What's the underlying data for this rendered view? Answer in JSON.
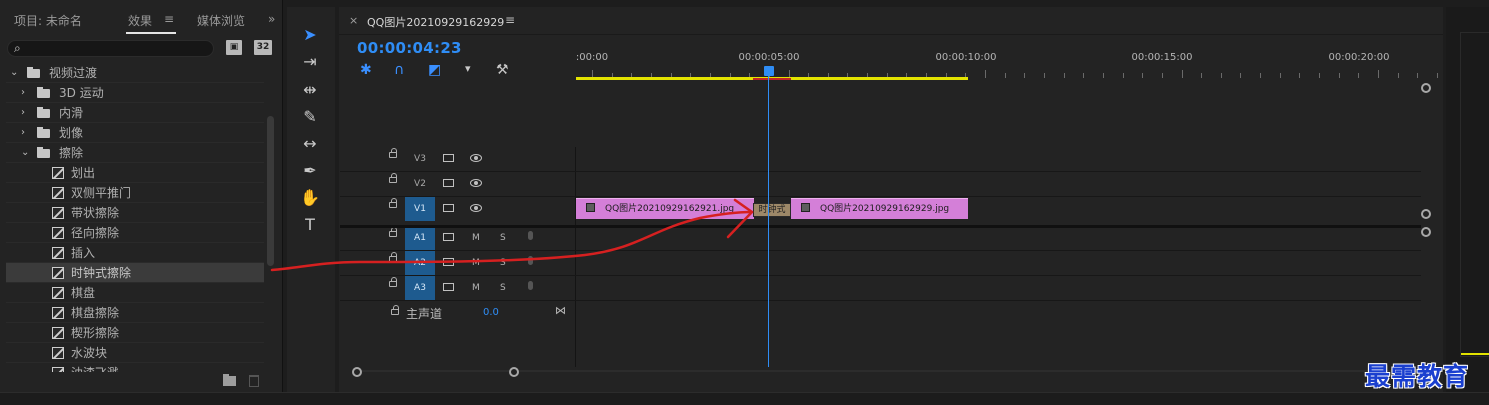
{
  "effects_panel": {
    "tabs": [
      {
        "label": "项目: 未命名"
      },
      {
        "label": "效果"
      },
      {
        "label": "媒体浏览"
      }
    ],
    "menu_icon": "hamburger-menu-icon",
    "overflow": "»",
    "search_value": "",
    "tool_icons": [
      "32",
      "32"
    ],
    "tree": [
      {
        "label": "视频过渡",
        "type": "folder",
        "expanded": true
      },
      {
        "label": "3D 运动",
        "type": "folder",
        "expanded": false
      },
      {
        "label": "内滑",
        "type": "folder",
        "expanded": false
      },
      {
        "label": "划像",
        "type": "folder",
        "expanded": false
      },
      {
        "label": "擦除",
        "type": "folder",
        "expanded": true
      },
      {
        "label": "划出",
        "type": "effect"
      },
      {
        "label": "双侧平推门",
        "type": "effect"
      },
      {
        "label": "带状擦除",
        "type": "effect"
      },
      {
        "label": "径向擦除",
        "type": "effect"
      },
      {
        "label": "插入",
        "type": "effect"
      },
      {
        "label": "时钟式擦除",
        "type": "effect",
        "selected": true
      },
      {
        "label": "棋盘",
        "type": "effect"
      },
      {
        "label": "棋盘擦除",
        "type": "effect"
      },
      {
        "label": "楔形擦除",
        "type": "effect"
      },
      {
        "label": "水波块",
        "type": "effect"
      },
      {
        "label": "油漆飞溅",
        "type": "effect"
      }
    ]
  },
  "tools": [
    "selection-tool-icon",
    "track-select-icon",
    "ripple-edit-icon",
    "razor-icon",
    "slip-icon",
    "pen-icon",
    "hand-icon",
    "type-icon"
  ],
  "timeline": {
    "close_glyph": "×",
    "title": "QQ图片20210929162929",
    "menu_glyph": "≡",
    "timecode": "00:00:04:23",
    "ruler_labels": [
      ":00:00",
      "00:00:05:00",
      "00:00:10:00",
      "00:00:15:00",
      "00:00:20:00"
    ],
    "tracks": [
      {
        "name": "V3",
        "kind": "video",
        "targeted": false
      },
      {
        "name": "V2",
        "kind": "video",
        "targeted": false
      },
      {
        "name": "V1",
        "kind": "video",
        "targeted": true
      },
      {
        "name": "A1",
        "kind": "audio",
        "targeted": true
      },
      {
        "name": "A2",
        "kind": "audio",
        "targeted": true
      },
      {
        "name": "A3",
        "kind": "audio",
        "targeted": true
      }
    ],
    "audio_mute": "M",
    "audio_solo": "S",
    "master_label": "主声道",
    "master_value": "0.0",
    "clips": [
      {
        "name": "QQ图片20210929162921.jpg"
      },
      {
        "name": "QQ图片20210929162929.jpg"
      }
    ],
    "transition_label": "时钟式",
    "clip_color": "#d47fd8",
    "playhead_color": "#2f8df5",
    "workarea_color": "#e3e300"
  },
  "watermark": "最需教育"
}
